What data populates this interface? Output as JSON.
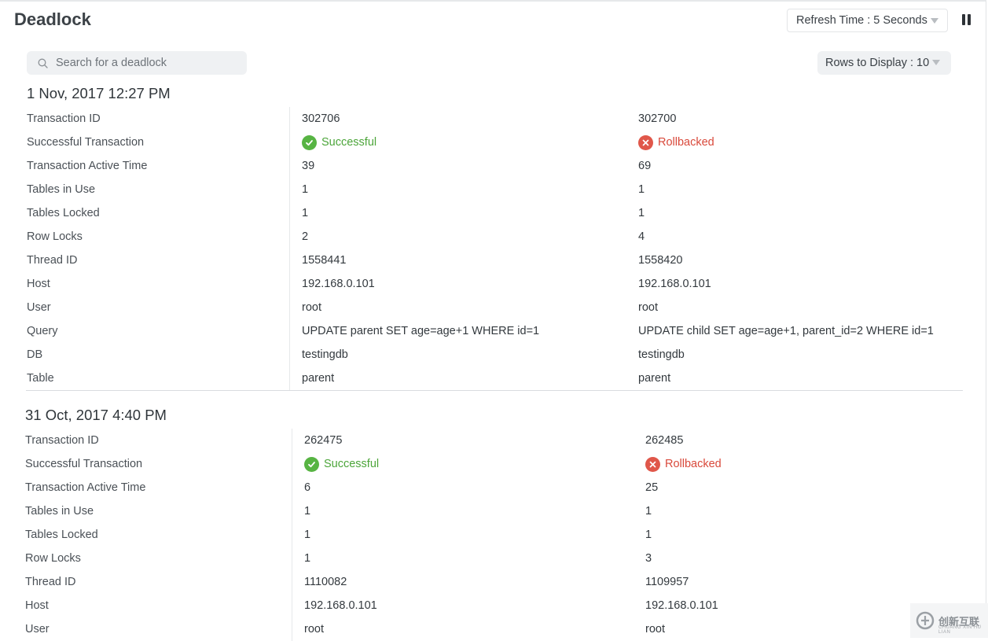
{
  "header": {
    "title": "Deadlock",
    "refresh_label": "Refresh Time : 5 Seconds",
    "rows_label": "Rows to Display : 10"
  },
  "search": {
    "placeholder": "Search for a deadlock"
  },
  "labels": {
    "transaction_id": "Transaction ID",
    "successful_transaction": "Successful Transaction",
    "active_time": "Transaction Active Time",
    "tables_in_use": "Tables in Use",
    "tables_locked": "Tables Locked",
    "row_locks": "Row Locks",
    "thread_id": "Thread ID",
    "host": "Host",
    "user": "User",
    "query": "Query",
    "db": "DB",
    "table": "Table"
  },
  "deadlocks": [
    {
      "date": "1 Nov, 2017 12:27 PM",
      "transactions": [
        {
          "transaction_id": "302706",
          "status": "Successful",
          "active_time": "39",
          "tables_in_use": "1",
          "tables_locked": "1",
          "row_locks": "2",
          "thread_id": "1558441",
          "host": "192.168.0.101",
          "user": "root",
          "query": "UPDATE parent SET age=age+1 WHERE id=1",
          "db": "testingdb",
          "table": "parent"
        },
        {
          "transaction_id": "302700",
          "status": "Rollbacked",
          "active_time": "69",
          "tables_in_use": "1",
          "tables_locked": "1",
          "row_locks": "4",
          "thread_id": "1558420",
          "host": "192.168.0.101",
          "user": "root",
          "query": "UPDATE child SET age=age+1, parent_id=2 WHERE id=1",
          "db": "testingdb",
          "table": "parent"
        }
      ]
    },
    {
      "date": "31 Oct, 2017 4:40 PM",
      "transactions": [
        {
          "transaction_id": "262475",
          "status": "Successful",
          "active_time": "6",
          "tables_in_use": "1",
          "tables_locked": "1",
          "row_locks": "1",
          "thread_id": "1110082",
          "host": "192.168.0.101",
          "user": "root"
        },
        {
          "transaction_id": "262485",
          "status": "Rollbacked",
          "active_time": "25",
          "tables_in_use": "1",
          "tables_locked": "1",
          "row_locks": "3",
          "thread_id": "1109957",
          "host": "192.168.0.101",
          "user": "root"
        }
      ]
    }
  ],
  "colors": {
    "success": "#4ca53a",
    "rollback": "#d9493b"
  },
  "icons": {
    "search": "search-icon",
    "caret": "chevron-down-icon",
    "pause": "pause-icon",
    "success": "check-circle-icon",
    "rollback": "x-circle-icon"
  },
  "watermark": {
    "text": "创新互联",
    "subtext": "CHUANG XIN HU LIAN"
  }
}
